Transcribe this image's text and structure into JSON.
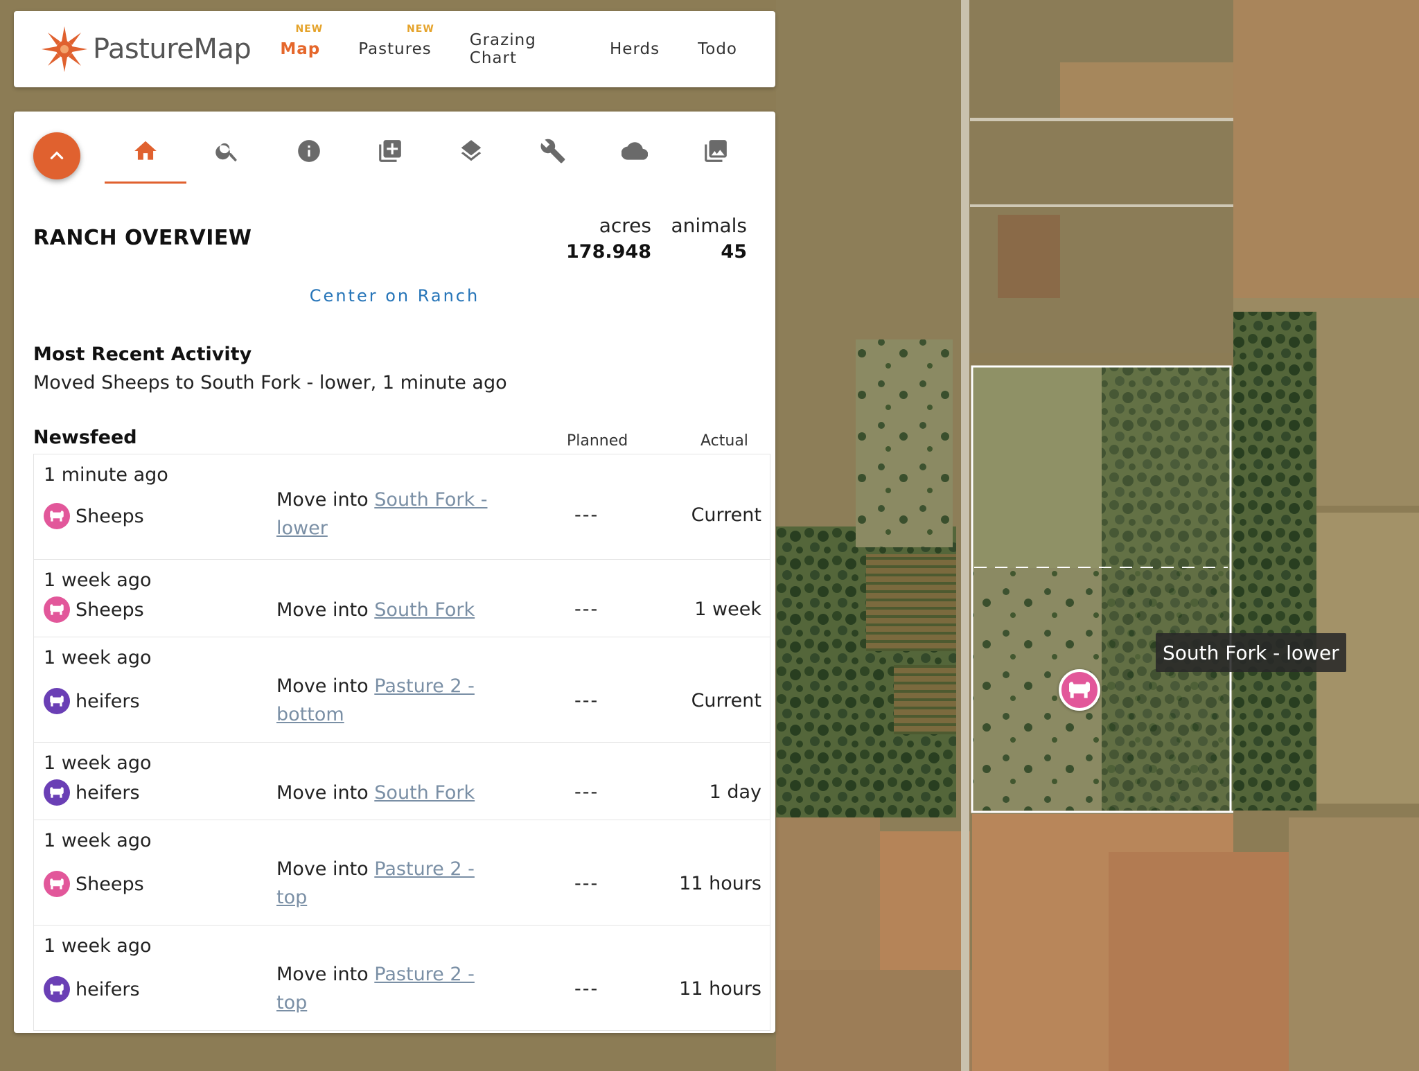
{
  "brand": {
    "name": "PastureMap",
    "accent": "#e0612f"
  },
  "nav": {
    "items": [
      {
        "label": "Map",
        "badge": "NEW",
        "active": true
      },
      {
        "label": "Pastures",
        "badge": "NEW",
        "active": false
      },
      {
        "label": "Grazing Chart",
        "badge": "",
        "active": false
      },
      {
        "label": "Herds",
        "badge": "",
        "active": false
      },
      {
        "label": "Todo",
        "badge": "",
        "active": false
      }
    ]
  },
  "toolbar": {
    "tools": [
      "home-icon",
      "search-icon",
      "info-icon",
      "add-layer-icon",
      "layers-icon",
      "wrench-icon",
      "cloud-icon",
      "photo-library-icon"
    ],
    "active": "home-icon"
  },
  "overview": {
    "title": "RANCH OVERVIEW",
    "acres_label": "acres",
    "acres_value": "178.948",
    "animals_label": "animals",
    "animals_value": "45",
    "center_link": "Center on Ranch"
  },
  "recent": {
    "title": "Most Recent Activity",
    "text": "Moved Sheeps to South Fork - lower, 1 minute ago"
  },
  "newsfeed": {
    "title": "Newsfeed",
    "col_planned": "Planned",
    "col_actual": "Actual",
    "rows": [
      {
        "time": "1 minute ago",
        "herd": "Sheeps",
        "herd_color": "#e2579a",
        "action": "Move into ",
        "pasture": "South Fork - lower",
        "planned": "---",
        "actual": "Current"
      },
      {
        "time": "1 week ago",
        "herd": "Sheeps",
        "herd_color": "#e2579a",
        "action": "Move into ",
        "pasture": "South Fork",
        "planned": "---",
        "actual": "1 week"
      },
      {
        "time": "1 week ago",
        "herd": "heifers",
        "herd_color": "#6a3fb5",
        "action": "Move into ",
        "pasture": "Pasture 2 - bottom",
        "planned": "---",
        "actual": "Current"
      },
      {
        "time": "1 week ago",
        "herd": "heifers",
        "herd_color": "#6a3fb5",
        "action": "Move into ",
        "pasture": "South Fork",
        "planned": "---",
        "actual": "1 day"
      },
      {
        "time": "1 week ago",
        "herd": "Sheeps",
        "herd_color": "#e2579a",
        "action": "Move into ",
        "pasture": "Pasture 2 - top",
        "planned": "---",
        "actual": "11 hours"
      },
      {
        "time": "1 week ago",
        "herd": "heifers",
        "herd_color": "#6a3fb5",
        "action": "Move into ",
        "pasture": "Pasture 2 - top",
        "planned": "---",
        "actual": "11 hours"
      }
    ]
  },
  "map": {
    "pasture_label": "South Fork - lower",
    "marker_color": "#e2579a"
  }
}
